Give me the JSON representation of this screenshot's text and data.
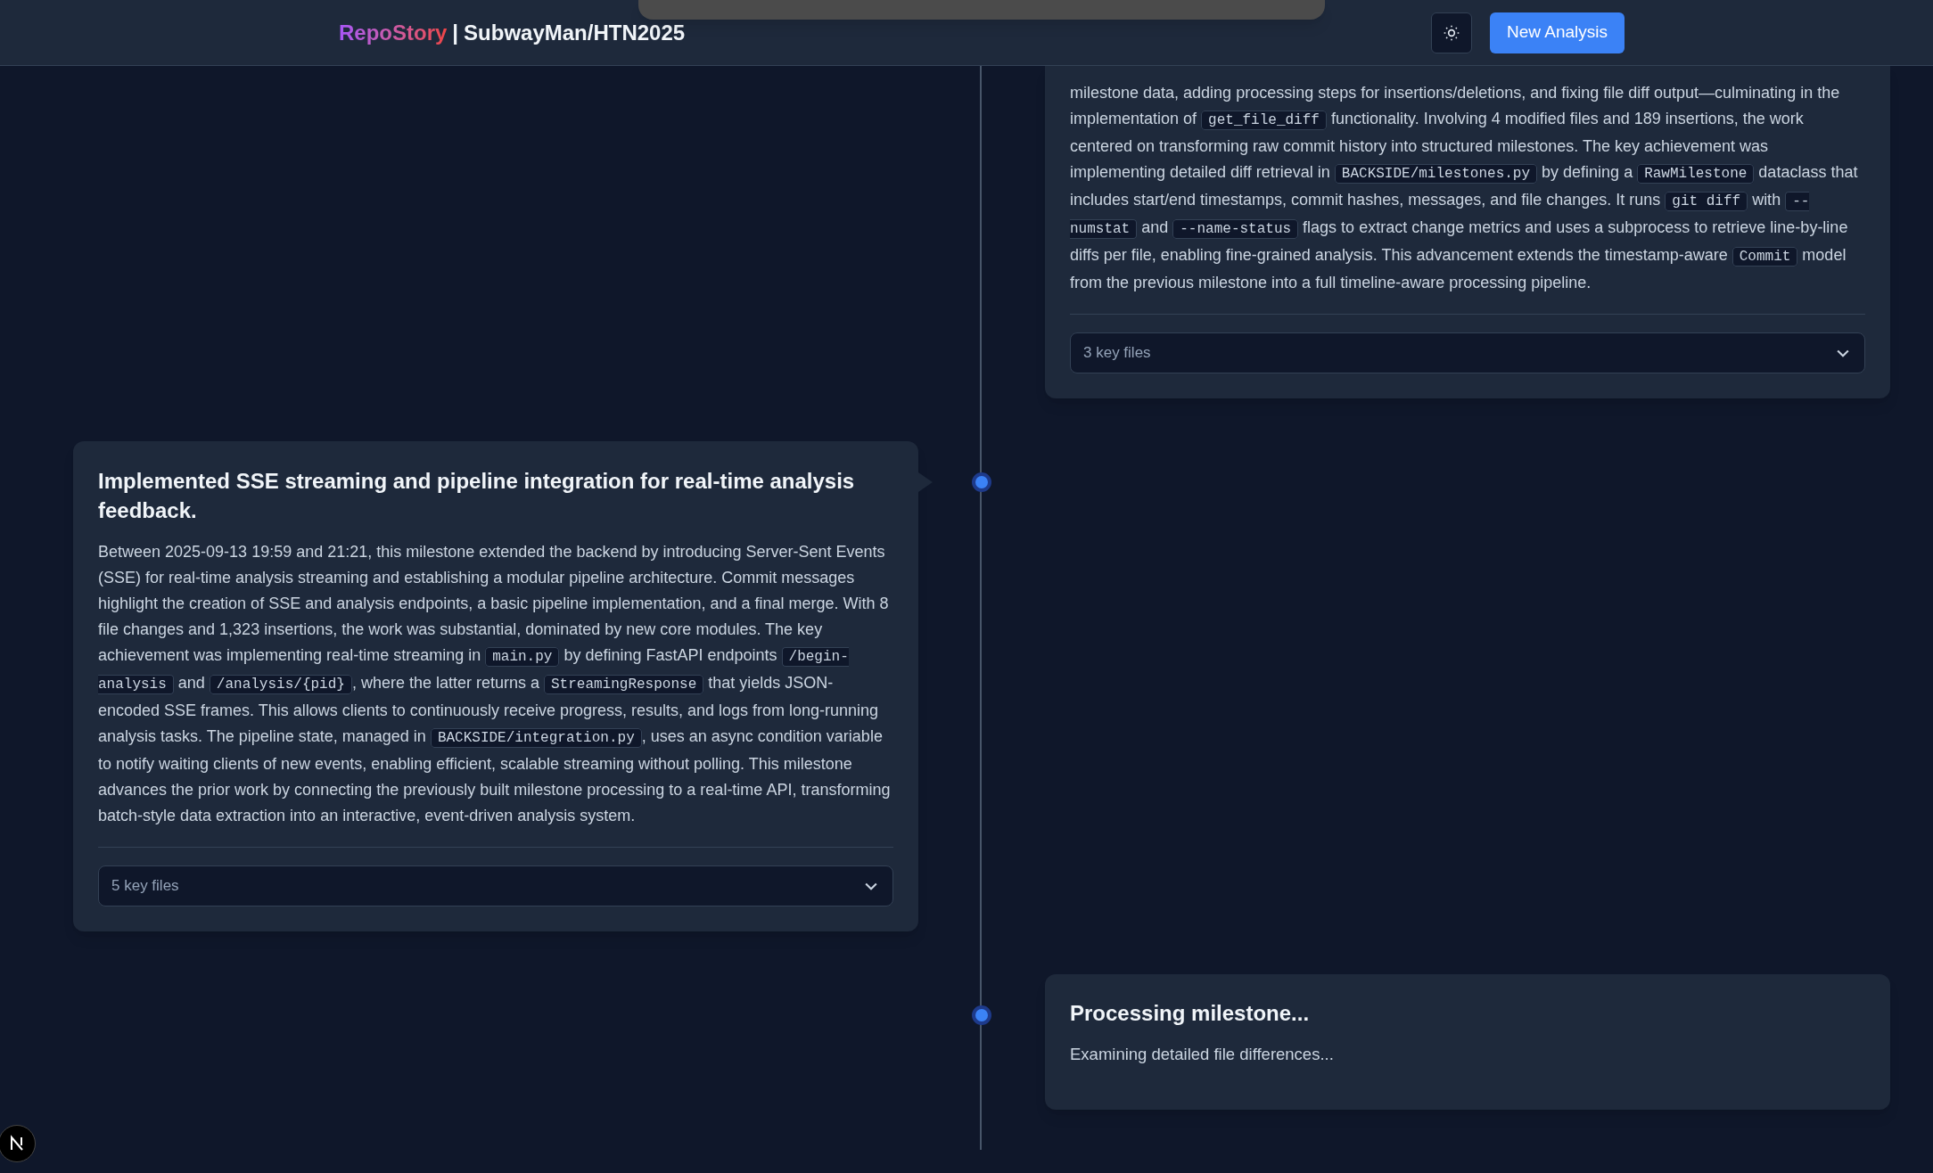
{
  "header": {
    "brand": "RepoStory",
    "separator": "|",
    "repo": "SubwayMan/HTN2025",
    "new_button": "New Analysis"
  },
  "milestones": [
    {
      "kind": "summary",
      "summary": [
        {
          "kind": "text",
          "text": "milestone data, adding processing steps for insertions/deletions, and fixing file diff output—culminating in the implementation of "
        },
        {
          "kind": "code",
          "text": "get_file_diff"
        },
        {
          "kind": "text",
          "text": " functionality. Involving 4 modified files and 189 insertions, the work centered on transforming raw commit history into structured milestones. The key achievement was implementing detailed diff retrieval in "
        },
        {
          "kind": "code",
          "text": "BACKSIDE/milestones.py"
        },
        {
          "kind": "text",
          "text": " by defining a "
        },
        {
          "kind": "code",
          "text": "RawMilestone"
        },
        {
          "kind": "text",
          "text": " dataclass that includes start/end timestamps, commit hashes, messages, and file changes. It runs "
        },
        {
          "kind": "code",
          "text": "git diff"
        },
        {
          "kind": "text",
          "text": " with "
        },
        {
          "kind": "code",
          "text": "--numstat"
        },
        {
          "kind": "text",
          "text": " and "
        },
        {
          "kind": "code",
          "text": "--name-status"
        },
        {
          "kind": "text",
          "text": " flags to extract change metrics and uses a subprocess to retrieve line-by-line diffs per file, enabling fine-grained analysis. This advancement extends the timestamp-aware "
        },
        {
          "kind": "code",
          "text": "Commit"
        },
        {
          "kind": "text",
          "text": " model from the previous milestone into a full timeline-aware processing pipeline."
        }
      ],
      "key_files": "3 key files",
      "expanded": false
    },
    {
      "kind": "summary",
      "title": "Implemented SSE streaming and pipeline integration for real-time analysis feedback.",
      "summary": [
        {
          "kind": "text",
          "text": "Between 2025-09-13 19:59 and 21:21, this milestone extended the backend by introducing Server-Sent Events (SSE) for real-time analysis streaming and establishing a modular pipeline architecture. Commit messages highlight the creation of SSE and analysis endpoints, a basic pipeline implementation, and a final merge. With 8 file changes and 1,323 insertions, the work was substantial, dominated by new core modules. The key achievement was implementing real-time streaming in "
        },
        {
          "kind": "code",
          "text": "main.py"
        },
        {
          "kind": "text",
          "text": " by defining FastAPI endpoints "
        },
        {
          "kind": "code",
          "text": "/begin-analysis"
        },
        {
          "kind": "text",
          "text": " and "
        },
        {
          "kind": "code",
          "text": "/analysis/{pid}"
        },
        {
          "kind": "text",
          "text": ", where the latter returns a "
        },
        {
          "kind": "code",
          "text": "StreamingResponse"
        },
        {
          "kind": "text",
          "text": " that yields JSON-encoded SSE frames. This allows clients to continuously receive progress, results, and logs from long-running analysis tasks. The pipeline state, managed in "
        },
        {
          "kind": "code",
          "text": "BACKSIDE/integration.py"
        },
        {
          "kind": "text",
          "text": ", uses an async condition variable to notify waiting clients of new events, enabling efficient, scalable streaming without polling. This milestone advances the prior work by connecting the previously built milestone processing to a real-time API, transforming batch-style data extraction into an interactive, event-driven analysis system."
        }
      ],
      "key_files": "5 key files",
      "expanded": false
    },
    {
      "kind": "processing",
      "title": "Processing milestone...",
      "message": "Examining detailed file differences..."
    }
  ]
}
